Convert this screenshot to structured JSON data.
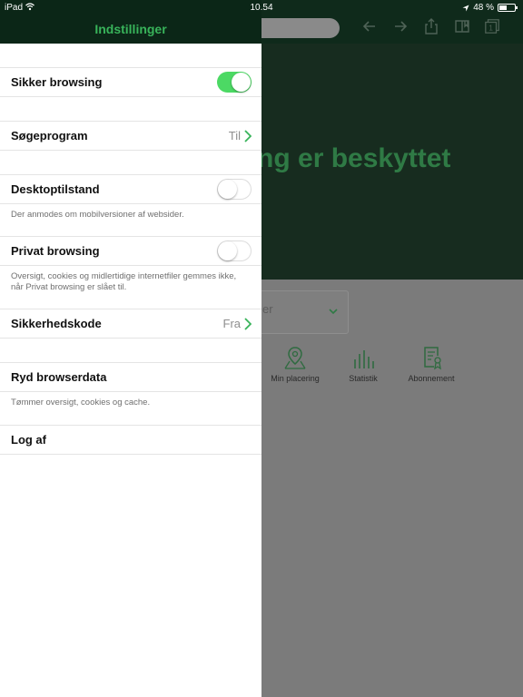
{
  "status_bar": {
    "device": "iPad",
    "time": "10.54",
    "battery": "48 %",
    "battery_level": 0.48
  },
  "background": {
    "hero_text": "sing er beskyttet",
    "dropdown_text": "er",
    "features": [
      {
        "label": "Min placering",
        "icon": "map-pin-icon"
      },
      {
        "label": "Statistik",
        "icon": "bar-chart-icon"
      },
      {
        "label": "Abonnement",
        "icon": "certificate-icon"
      }
    ],
    "toolbar_icons": [
      "back-arrow-icon",
      "forward-arrow-icon",
      "share-icon",
      "bookmarks-icon",
      "tabs-icon"
    ],
    "tabs_count": "1"
  },
  "settings": {
    "title": "Indstillinger",
    "safe_browsing": {
      "label": "Sikker browsing",
      "enabled": true
    },
    "search_engine": {
      "label": "Søgeprogram",
      "value": "Til"
    },
    "desktop_mode": {
      "label": "Desktoptilstand",
      "enabled": false,
      "note": "Der anmodes om mobilversioner af websider."
    },
    "private_browsing": {
      "label": "Privat browsing",
      "enabled": false,
      "note": "Oversigt, cookies og midlertidige internetfiler gemmes ikke, når Privat browsing er slået til."
    },
    "security_code": {
      "label": "Sikkerhedskode",
      "value": "Fra"
    },
    "clear_data": {
      "label": "Ryd browserdata",
      "note": "Tømmer oversigt, cookies og cache."
    },
    "logout": {
      "label": "Log af"
    }
  },
  "colors": {
    "accent_green": "#38b35a",
    "toggle_on": "#4cd964",
    "header_dark": "#0b2617"
  }
}
